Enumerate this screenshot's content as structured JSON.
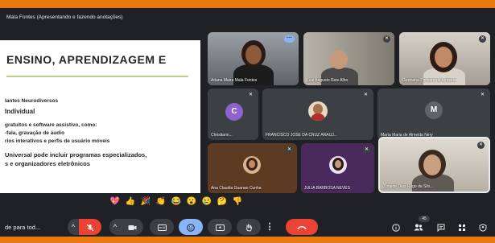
{
  "presenter_label": "Mala Fontes (Apresentando e fazendo anotações)",
  "slide": {
    "title": "ENSINO, APRENDIZAGEM E",
    "lines": [
      "lantes Neurodiversos",
      "Individual",
      "gratuitos e software assistivo, como:",
      "-fala, gravação de áudio",
      "rios interativos e perfis de usuário móveis",
      "Universal pode incluir programas especializados,",
      "s e organizadores eletrônicos"
    ]
  },
  "participants": [
    {
      "name": "Ariana Maira Mala Fontes"
    },
    {
      "name": "Luiz Augusto Reis Alho"
    },
    {
      "name": "Germana Pinheiro de Almeida"
    },
    {
      "name": "Christiann...",
      "initial": "C"
    },
    {
      "name": "FRANCISCO JOSÉ DA CRUZ ARAUJ..."
    },
    {
      "name": "Marta Maria de Almeida Nery",
      "initial": "M"
    },
    {
      "name": "Ana Claudia Guanao Cunha"
    },
    {
      "name": "JULIA BARBOSA NEVES"
    },
    {
      "name": "Zoraide Dias Rêgo da Silv..."
    }
  ],
  "reactions": [
    "💖",
    "👍",
    "🎉",
    "👏",
    "😂",
    "😮",
    "😢",
    "🤔",
    "👎"
  ],
  "toolbar": {
    "meeting_label": "de para tod...",
    "participants_count": "45"
  },
  "colors": {
    "accent_bar": "#e97a10",
    "meet_bg": "#202124",
    "leave_red": "#ea4335",
    "reaction_blue": "#8ab4f8"
  }
}
